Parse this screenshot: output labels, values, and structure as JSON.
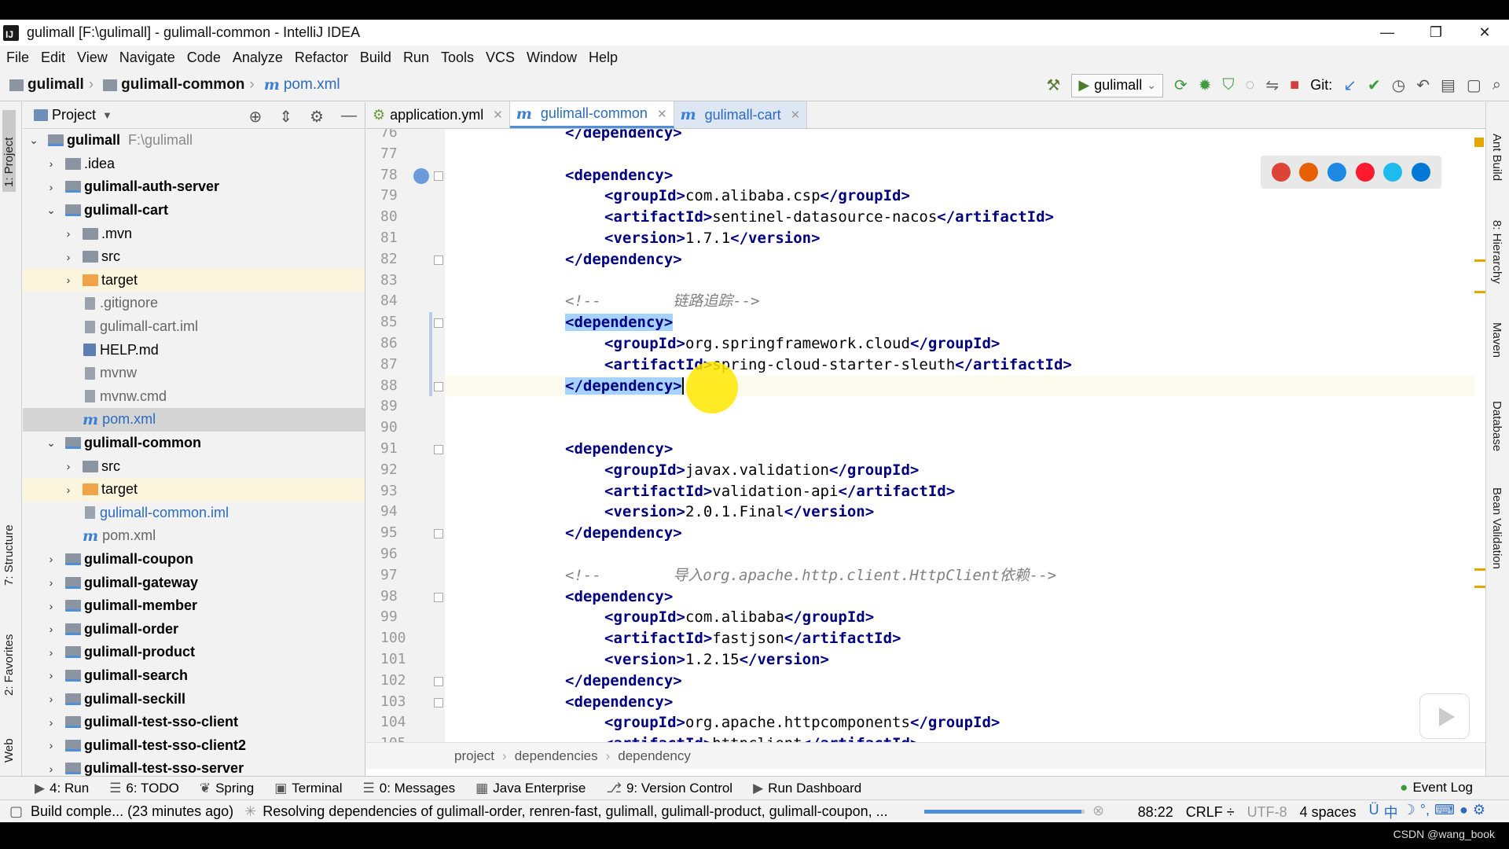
{
  "window": {
    "title": "gulimall [F:\\gulimall] - gulimall-common - IntelliJ IDEA",
    "app_icon_letter": "IJ",
    "controls": [
      "—",
      "❐",
      "✕"
    ]
  },
  "menu": [
    "File",
    "Edit",
    "View",
    "Navigate",
    "Code",
    "Analyze",
    "Refactor",
    "Build",
    "Run",
    "Tools",
    "VCS",
    "Window",
    "Help"
  ],
  "breadcrumb": {
    "root": "gulimall",
    "module": "gulimall-common",
    "file": "pom.xml"
  },
  "toolbar": {
    "run_config": "gulimall",
    "git_label": "Git:"
  },
  "left_tabs": {
    "project": "1: Project",
    "structure": "7: Structure",
    "favorites": "2: Favorites",
    "web": "Web"
  },
  "project_panel": {
    "title": "Project",
    "tree": [
      {
        "name": "gulimall",
        "path": "F:\\gulimall",
        "level": 0,
        "arrow": "⌄",
        "icon": "module",
        "bold": true
      },
      {
        "name": ".idea",
        "level": 1,
        "arrow": "›",
        "icon": "folder"
      },
      {
        "name": "gulimall-auth-server",
        "level": 1,
        "arrow": "›",
        "icon": "module",
        "bold": true
      },
      {
        "name": "gulimall-cart",
        "level": 1,
        "arrow": "⌄",
        "icon": "module",
        "bold": true
      },
      {
        "name": ".mvn",
        "level": 2,
        "arrow": "›",
        "icon": "folder"
      },
      {
        "name": "src",
        "level": 2,
        "arrow": "›",
        "icon": "folder"
      },
      {
        "name": "target",
        "level": 2,
        "arrow": "›",
        "icon": "orange",
        "highlight": true
      },
      {
        "name": ".gitignore",
        "level": 2,
        "icon": "file",
        "color": "gray"
      },
      {
        "name": "gulimall-cart.iml",
        "level": 2,
        "icon": "file",
        "color": "gray"
      },
      {
        "name": "HELP.md",
        "level": 2,
        "icon": "md"
      },
      {
        "name": "mvnw",
        "level": 2,
        "icon": "file",
        "color": "gray"
      },
      {
        "name": "mvnw.cmd",
        "level": 2,
        "icon": "file",
        "color": "gray"
      },
      {
        "name": "pom.xml",
        "level": 2,
        "icon": "m",
        "color": "blue",
        "selected": true
      },
      {
        "name": "gulimall-common",
        "level": 1,
        "arrow": "⌄",
        "icon": "module",
        "bold": true
      },
      {
        "name": "src",
        "level": 2,
        "arrow": "›",
        "icon": "folder"
      },
      {
        "name": "target",
        "level": 2,
        "arrow": "›",
        "icon": "orange",
        "highlight": true
      },
      {
        "name": "gulimall-common.iml",
        "level": 2,
        "icon": "file",
        "color": "blue"
      },
      {
        "name": "pom.xml",
        "level": 2,
        "icon": "m",
        "color": "gray"
      },
      {
        "name": "gulimall-coupon",
        "level": 1,
        "arrow": "›",
        "icon": "module",
        "bold": true
      },
      {
        "name": "gulimall-gateway",
        "level": 1,
        "arrow": "›",
        "icon": "module",
        "bold": true
      },
      {
        "name": "gulimall-member",
        "level": 1,
        "arrow": "›",
        "icon": "module",
        "bold": true
      },
      {
        "name": "gulimall-order",
        "level": 1,
        "arrow": "›",
        "icon": "module",
        "bold": true
      },
      {
        "name": "gulimall-product",
        "level": 1,
        "arrow": "›",
        "icon": "module",
        "bold": true
      },
      {
        "name": "gulimall-search",
        "level": 1,
        "arrow": "›",
        "icon": "module",
        "bold": true
      },
      {
        "name": "gulimall-seckill",
        "level": 1,
        "arrow": "›",
        "icon": "module",
        "bold": true
      },
      {
        "name": "gulimall-test-sso-client",
        "level": 1,
        "arrow": "›",
        "icon": "module",
        "bold": true
      },
      {
        "name": "gulimall-test-sso-client2",
        "level": 1,
        "arrow": "›",
        "icon": "module",
        "bold": true
      },
      {
        "name": "gulimall-test-sso-server",
        "level": 1,
        "arrow": "›",
        "icon": "module",
        "bold": true
      }
    ]
  },
  "editor": {
    "tabs": [
      {
        "label": "application.yml",
        "icon": "yml",
        "active": false
      },
      {
        "label": "gulimall-common",
        "icon": "m",
        "active": true
      },
      {
        "label": "gulimall-cart",
        "icon": "m",
        "active": false
      }
    ],
    "lines": [
      {
        "n": "76",
        "indent": 2,
        "parts": [
          {
            "t": "tag",
            "s": "</dependency>"
          }
        ]
      },
      {
        "n": "77",
        "indent": 0,
        "parts": []
      },
      {
        "n": "78",
        "indent": 2,
        "parts": [
          {
            "t": "tag",
            "s": "<dependency>"
          }
        ]
      },
      {
        "n": "79",
        "indent": 4,
        "parts": [
          {
            "t": "tag",
            "s": "<groupId>"
          },
          {
            "t": "text",
            "s": "com.alibaba.csp"
          },
          {
            "t": "tag",
            "s": "</groupId>"
          }
        ]
      },
      {
        "n": "80",
        "indent": 4,
        "parts": [
          {
            "t": "tag",
            "s": "<artifactId>"
          },
          {
            "t": "text",
            "s": "sentinel-datasource-nacos"
          },
          {
            "t": "tag",
            "s": "</artifactId>"
          }
        ]
      },
      {
        "n": "81",
        "indent": 4,
        "parts": [
          {
            "t": "tag",
            "s": "<version>"
          },
          {
            "t": "text",
            "s": "1.7.1"
          },
          {
            "t": "tag",
            "s": "</version>"
          }
        ]
      },
      {
        "n": "82",
        "indent": 2,
        "parts": [
          {
            "t": "tag",
            "s": "</dependency>"
          }
        ]
      },
      {
        "n": "83",
        "indent": 0,
        "parts": []
      },
      {
        "n": "84",
        "indent": 2,
        "parts": [
          {
            "t": "cmt",
            "s": "<!--        链路追踪-->"
          }
        ]
      },
      {
        "n": "85",
        "indent": 2,
        "parts": [
          {
            "t": "tagsel",
            "s": "<dependency>"
          }
        ]
      },
      {
        "n": "86",
        "indent": 4,
        "parts": [
          {
            "t": "tag",
            "s": "<groupId>"
          },
          {
            "t": "text",
            "s": "org.springframework.cloud"
          },
          {
            "t": "tag",
            "s": "</groupId>"
          }
        ]
      },
      {
        "n": "87",
        "indent": 4,
        "parts": [
          {
            "t": "tag",
            "s": "<artifactId>"
          },
          {
            "t": "text",
            "s": "spring-cloud-starter-sleuth"
          },
          {
            "t": "tag",
            "s": "</artifactId>"
          }
        ]
      },
      {
        "n": "88",
        "indent": 2,
        "cur": true,
        "parts": [
          {
            "t": "tagsel",
            "s": "</dependency>"
          },
          {
            "t": "cursor",
            "s": ""
          }
        ]
      },
      {
        "n": "89",
        "indent": 0,
        "parts": []
      },
      {
        "n": "90",
        "indent": 0,
        "parts": []
      },
      {
        "n": "91",
        "indent": 2,
        "parts": [
          {
            "t": "tag",
            "s": "<dependency>"
          }
        ]
      },
      {
        "n": "92",
        "indent": 4,
        "parts": [
          {
            "t": "tag",
            "s": "<groupId>"
          },
          {
            "t": "text",
            "s": "javax.validation"
          },
          {
            "t": "tag",
            "s": "</groupId>"
          }
        ]
      },
      {
        "n": "93",
        "indent": 4,
        "parts": [
          {
            "t": "tag",
            "s": "<artifactId>"
          },
          {
            "t": "text",
            "s": "validation-api"
          },
          {
            "t": "tag",
            "s": "</artifactId>"
          }
        ]
      },
      {
        "n": "94",
        "indent": 4,
        "parts": [
          {
            "t": "tag",
            "s": "<version>"
          },
          {
            "t": "text",
            "s": "2.0.1.Final"
          },
          {
            "t": "tag",
            "s": "</version>"
          }
        ]
      },
      {
        "n": "95",
        "indent": 2,
        "parts": [
          {
            "t": "tag",
            "s": "</dependency>"
          }
        ]
      },
      {
        "n": "96",
        "indent": 0,
        "parts": []
      },
      {
        "n": "97",
        "indent": 2,
        "parts": [
          {
            "t": "cmt",
            "s": "<!--        导入org.apache.http.client.HttpClient依赖-->"
          }
        ]
      },
      {
        "n": "98",
        "indent": 2,
        "parts": [
          {
            "t": "tag",
            "s": "<dependency>"
          }
        ]
      },
      {
        "n": "99",
        "indent": 4,
        "parts": [
          {
            "t": "tag",
            "s": "<groupId>"
          },
          {
            "t": "text",
            "s": "com.alibaba"
          },
          {
            "t": "tag",
            "s": "</groupId>"
          }
        ]
      },
      {
        "n": "100",
        "indent": 4,
        "parts": [
          {
            "t": "tag",
            "s": "<artifactId>"
          },
          {
            "t": "text",
            "s": "fastjson"
          },
          {
            "t": "tag",
            "s": "</artifactId>"
          }
        ]
      },
      {
        "n": "101",
        "indent": 4,
        "parts": [
          {
            "t": "tag",
            "s": "<version>"
          },
          {
            "t": "text",
            "s": "1.2.15"
          },
          {
            "t": "tag",
            "s": "</version>"
          }
        ]
      },
      {
        "n": "102",
        "indent": 2,
        "parts": [
          {
            "t": "tag",
            "s": "</dependency>"
          }
        ]
      },
      {
        "n": "103",
        "indent": 2,
        "parts": [
          {
            "t": "tag",
            "s": "<dependency>"
          }
        ]
      },
      {
        "n": "104",
        "indent": 4,
        "parts": [
          {
            "t": "tag",
            "s": "<groupId>"
          },
          {
            "t": "text",
            "s": "org.apache.httpcomponents"
          },
          {
            "t": "tag",
            "s": "</groupId>"
          }
        ]
      },
      {
        "n": "105",
        "indent": 4,
        "parts": [
          {
            "t": "tag",
            "s": "<artifactId>"
          },
          {
            "t": "text",
            "s": "httpclient"
          },
          {
            "t": "tag",
            "s": "</artifactId>"
          }
        ]
      }
    ],
    "nav_breadcrumb": [
      "project",
      "dependencies",
      "dependency"
    ]
  },
  "browser_icons": [
    {
      "name": "chrome-icon",
      "color": "#db4437"
    },
    {
      "name": "firefox-icon",
      "color": "#e66000"
    },
    {
      "name": "safari-icon",
      "color": "#1e88e5"
    },
    {
      "name": "opera-icon",
      "color": "#ff1b2d"
    },
    {
      "name": "ie-icon",
      "color": "#1ebbee"
    },
    {
      "name": "edge-icon",
      "color": "#0078d7"
    }
  ],
  "right_tabs": [
    "Ant Build",
    "8: Hierarchy",
    "Maven",
    "Database",
    "Bean Validation"
  ],
  "tool_windows": [
    {
      "label": "4: Run",
      "icon": "▶"
    },
    {
      "label": "6: TODO",
      "icon": "☰"
    },
    {
      "label": "Spring",
      "icon": "❦"
    },
    {
      "label": "Terminal",
      "icon": "▣"
    },
    {
      "label": "0: Messages",
      "icon": "☰"
    },
    {
      "label": "Java Enterprise",
      "icon": "▦"
    },
    {
      "label": "9: Version Control",
      "icon": "⎇"
    },
    {
      "label": "Run Dashboard",
      "icon": "▶"
    }
  ],
  "event_log": "Event Log",
  "status": {
    "build": "Build comple... (23 minutes ago)",
    "resolving": "Resolving dependencies of gulimall-order, renren-fast, gulimall, gulimall-product, gulimall-coupon, ...",
    "position": "88:22",
    "line_sep": "CRLF ÷",
    "encoding": "UTF-8",
    "indent": "4 spaces",
    "ime": "中"
  },
  "watermark": "CSDN @wang_book"
}
